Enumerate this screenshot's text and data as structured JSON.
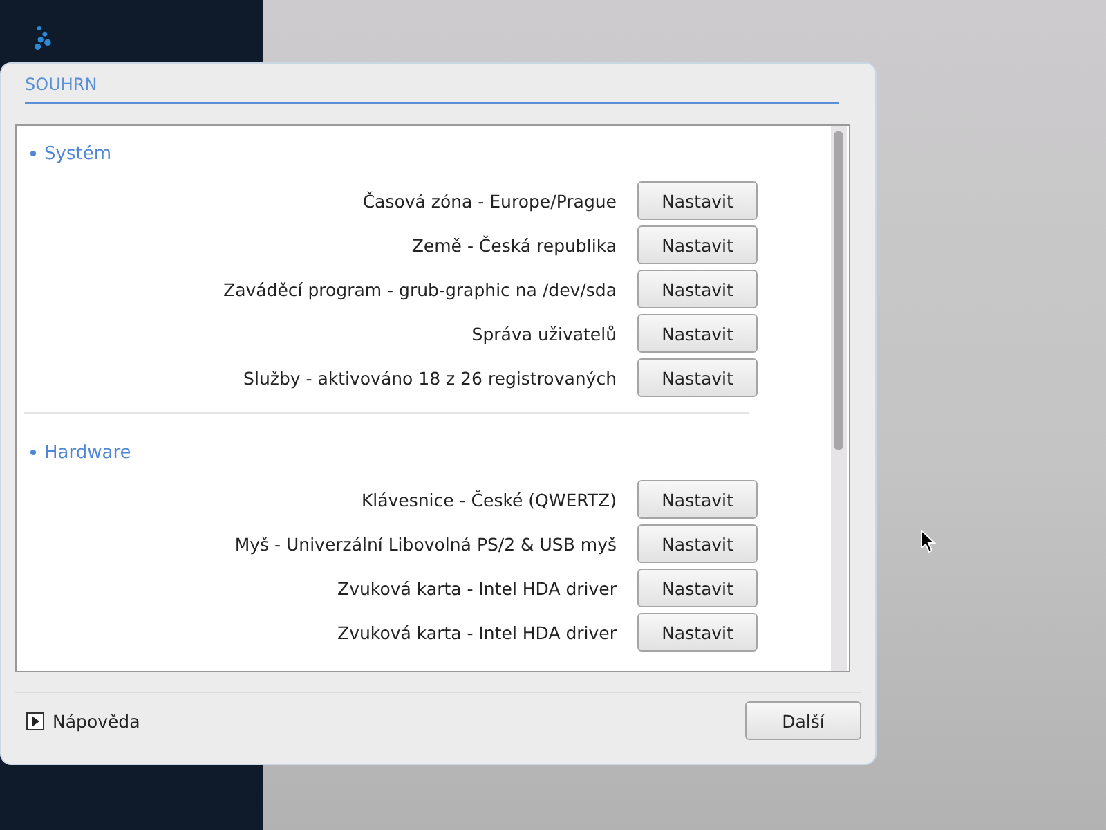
{
  "dialog": {
    "title": "SOUHRN",
    "sections": [
      {
        "title": "Systém",
        "items": [
          {
            "label": "Časová zóna - Europe/Prague",
            "button": "Nastavit"
          },
          {
            "label": "Země - Česká republika",
            "button": "Nastavit"
          },
          {
            "label": "Zaváděcí program - grub-graphic na /dev/sda",
            "button": "Nastavit"
          },
          {
            "label": "Správa uživatelů",
            "button": "Nastavit"
          },
          {
            "label": "Služby - aktivováno 18 z 26 registrovaných",
            "button": "Nastavit"
          }
        ]
      },
      {
        "title": "Hardware",
        "items": [
          {
            "label": "Klávesnice - České (QWERTZ)",
            "button": "Nastavit"
          },
          {
            "label": "Myš - Univerzální Libovolná PS/2 & USB myš",
            "button": "Nastavit"
          },
          {
            "label": "Zvuková karta - Intel HDA driver",
            "button": "Nastavit"
          },
          {
            "label": "Zvuková karta - Intel HDA driver",
            "button": "Nastavit"
          }
        ]
      }
    ],
    "help": {
      "label": "Nápověda",
      "expanded": false
    },
    "next_button": "Další"
  }
}
